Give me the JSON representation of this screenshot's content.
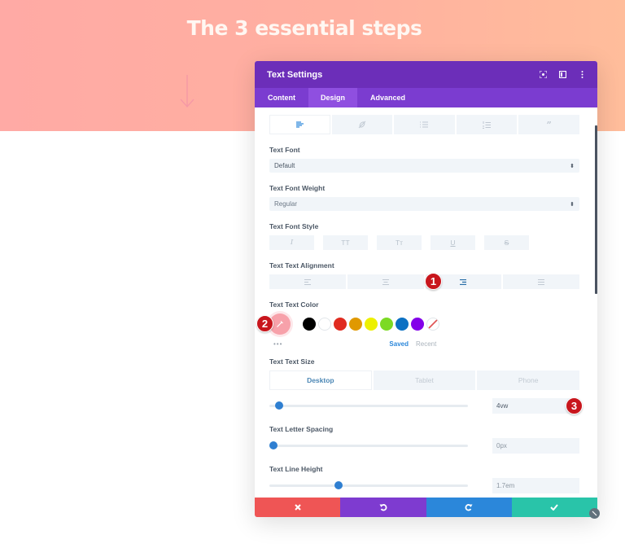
{
  "hero": {
    "title": "The 3 essential steps",
    "arrow_icon": "arrow-down-icon"
  },
  "modal": {
    "title": "Text Settings",
    "header_icons": [
      "fullscreen-icon",
      "split-view-icon",
      "more-vertical-icon"
    ],
    "tabs": [
      {
        "label": "Content",
        "active": false
      },
      {
        "label": "Design",
        "active": true
      },
      {
        "label": "Advanced",
        "active": false
      }
    ],
    "text_tabs": [
      {
        "icon": "paragraph-align-icon",
        "active": true
      },
      {
        "icon": "link-icon",
        "active": false
      },
      {
        "icon": "unordered-list-icon",
        "active": false
      },
      {
        "icon": "ordered-list-icon",
        "active": false
      },
      {
        "icon": "quote-icon",
        "active": false
      }
    ],
    "fields": {
      "text_font": {
        "label": "Text Font",
        "value": "Default"
      },
      "text_font_weight": {
        "label": "Text Font Weight",
        "value": "Regular"
      },
      "text_font_style": {
        "label": "Text Font Style",
        "options": [
          {
            "glyph": "I",
            "name": "italic"
          },
          {
            "glyph": "TT",
            "name": "uppercase"
          },
          {
            "glyph": "Tт",
            "name": "capitalize"
          },
          {
            "glyph": "U",
            "name": "underline"
          },
          {
            "glyph": "S",
            "name": "strikethrough"
          }
        ]
      },
      "text_alignment": {
        "label": "Text Text Alignment",
        "options": [
          "left",
          "center",
          "right",
          "justify"
        ],
        "selected": "right"
      },
      "text_color": {
        "label": "Text Text Color",
        "current": "#f7a1aa",
        "swatches": [
          "#000000",
          "#ffffff",
          "#e02b20",
          "#e09900",
          "#edf000",
          "#7cda24",
          "#0c71c3",
          "#8300e9"
        ],
        "more_label": "•••",
        "saved_label": "Saved",
        "recent_label": "Recent"
      },
      "text_size": {
        "label": "Text Text Size",
        "devices": [
          {
            "label": "Desktop",
            "active": true
          },
          {
            "label": "Tablet",
            "active": false
          },
          {
            "label": "Phone",
            "active": false
          }
        ],
        "value": "4vw",
        "slider_fraction": 0.05
      },
      "letter_spacing": {
        "label": "Text Letter Spacing",
        "value": "0px",
        "slider_fraction": 0.02
      },
      "line_height": {
        "label": "Text Line Height",
        "value": "1.7em",
        "slider_fraction": 0.35
      }
    },
    "badges": [
      "1",
      "2",
      "3"
    ],
    "footer": {
      "buttons": [
        {
          "name": "discard",
          "icon": "close-icon",
          "color": "#ef5555"
        },
        {
          "name": "undo",
          "icon": "undo-icon",
          "color": "#7e3bd0"
        },
        {
          "name": "redo",
          "icon": "redo-icon",
          "color": "#2b87da"
        },
        {
          "name": "save",
          "icon": "check-icon",
          "color": "#29c4a9"
        }
      ]
    }
  },
  "colors": {
    "header_bg": "#6c2eb9",
    "tabs_bg": "#7b3cd0",
    "accent": "#2b87da",
    "badge": "#c8161d"
  }
}
